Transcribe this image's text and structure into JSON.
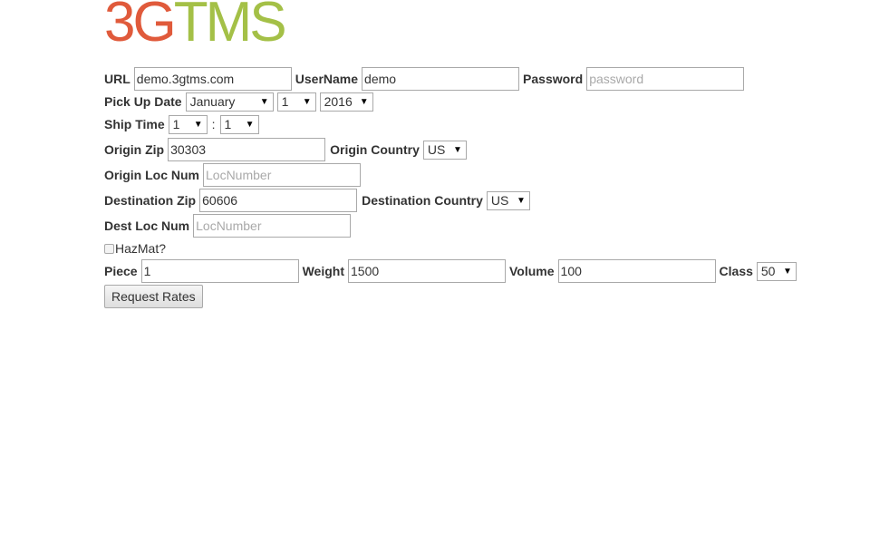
{
  "logo": {
    "part1": "3G",
    "part2": "TMS",
    "colors": {
      "part1": "#e05a3b",
      "part2": "#a4c047"
    }
  },
  "form": {
    "url": {
      "label": "URL",
      "value": "demo.3gtms.com"
    },
    "username": {
      "label": "UserName",
      "value": "demo"
    },
    "password": {
      "label": "Password",
      "placeholder": "password"
    },
    "pickup_date": {
      "label": "Pick Up Date",
      "month": "January",
      "day": "1",
      "year": "2016"
    },
    "ship_time": {
      "label": "Ship Time",
      "hour": "1",
      "separator": ":",
      "minute": "1"
    },
    "origin_zip": {
      "label": "Origin Zip",
      "value": "30303"
    },
    "origin_country": {
      "label": "Origin Country",
      "value": "US"
    },
    "origin_loc_num": {
      "label": "Origin Loc Num",
      "placeholder": "LocNumber"
    },
    "destination_zip": {
      "label": "Destination Zip",
      "value": "60606"
    },
    "destination_country": {
      "label": "Destination Country",
      "value": "US"
    },
    "dest_loc_num": {
      "label": "Dest Loc Num",
      "placeholder": "LocNumber"
    },
    "hazmat": {
      "label": "HazMat?",
      "checked": false
    },
    "piece": {
      "label": "Piece",
      "value": "1"
    },
    "weight": {
      "label": "Weight",
      "value": "1500"
    },
    "volume": {
      "label": "Volume",
      "value": "100"
    },
    "class": {
      "label": "Class",
      "value": "50"
    },
    "submit_label": "Request Rates"
  }
}
